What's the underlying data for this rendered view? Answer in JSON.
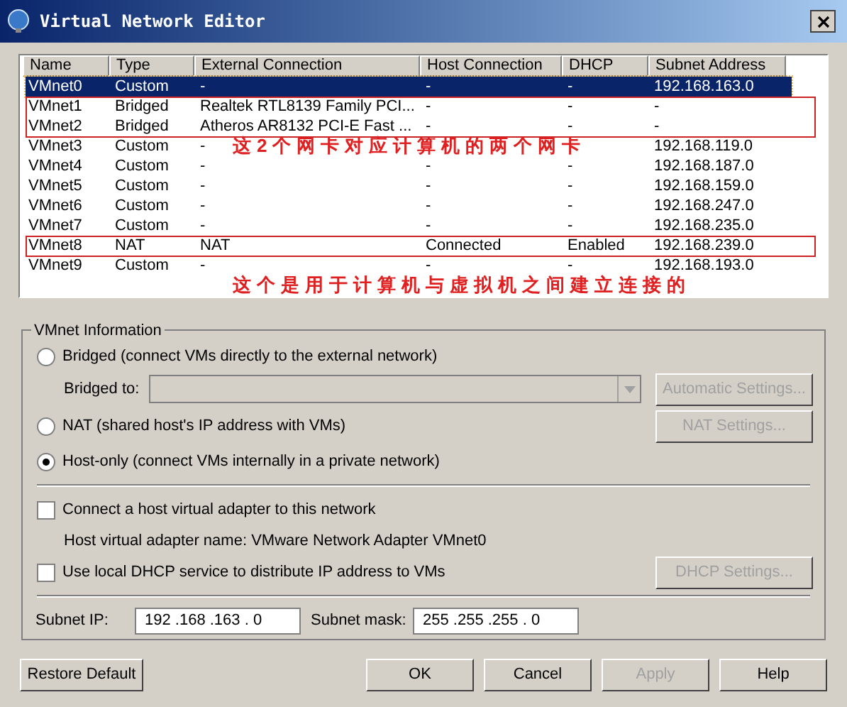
{
  "window": {
    "title": "Virtual Network Editor"
  },
  "table": {
    "columns": [
      "Name",
      "Type",
      "External Connection",
      "Host Connection",
      "DHCP",
      "Subnet Address"
    ],
    "rows": [
      {
        "name": "VMnet0",
        "type": "Custom",
        "external": "-",
        "host": "-",
        "dhcp": "-",
        "subnet": "192.168.163.0",
        "selected": true,
        "outlined": false
      },
      {
        "name": "VMnet1",
        "type": "Bridged",
        "external": "Realtek RTL8139 Family PCI...",
        "host": "-",
        "dhcp": "-",
        "subnet": "-",
        "selected": false,
        "outlined": true
      },
      {
        "name": "VMnet2",
        "type": "Bridged",
        "external": "Atheros AR8132 PCI-E Fast ...",
        "host": "-",
        "dhcp": "-",
        "subnet": "-",
        "selected": false,
        "outlined": true
      },
      {
        "name": "VMnet3",
        "type": "Custom",
        "external": "-",
        "subnet": "192.168.119.0",
        "selected": false,
        "outlined": false
      },
      {
        "name": "VMnet4",
        "type": "Custom",
        "external": "-",
        "host": "-",
        "dhcp": "-",
        "subnet": "192.168.187.0",
        "selected": false,
        "outlined": false
      },
      {
        "name": "VMnet5",
        "type": "Custom",
        "external": "-",
        "host": "-",
        "dhcp": "-",
        "subnet": "192.168.159.0",
        "selected": false,
        "outlined": false
      },
      {
        "name": "VMnet6",
        "type": "Custom",
        "external": "-",
        "host": "-",
        "dhcp": "-",
        "subnet": "192.168.247.0",
        "selected": false,
        "outlined": false
      },
      {
        "name": "VMnet7",
        "type": "Custom",
        "external": "-",
        "host": "-",
        "dhcp": "-",
        "subnet": "192.168.235.0",
        "selected": false,
        "outlined": false
      },
      {
        "name": "VMnet8",
        "type": "NAT",
        "external": "NAT",
        "host": "Connected",
        "dhcp": "Enabled",
        "subnet": "192.168.239.0",
        "selected": false,
        "outlined": true
      },
      {
        "name": "VMnet9",
        "type": "Custom",
        "external": "-",
        "host": "-",
        "dhcp": "-",
        "subnet": "192.168.193.0",
        "selected": false,
        "outlined": false
      }
    ]
  },
  "annotations": [
    "这2个网卡对应计算机的两个网卡",
    "这个是用于计算机与虚拟机之间建立连接的"
  ],
  "vmnet_information": {
    "title": "VMnet Information",
    "modes": [
      {
        "label": "Bridged (connect VMs directly to the external network)",
        "selected": false
      },
      {
        "label": "NAT (shared host's IP address with VMs)",
        "selected": false
      },
      {
        "label": "Host-only (connect VMs internally in a private network)",
        "selected": true
      }
    ],
    "bridged_to": {
      "label": "Bridged to:",
      "disabled": true
    },
    "automatic_settings": {
      "label": "Automatic Settings...",
      "disabled": true
    },
    "nat_settings": {
      "label": "NAT Settings...",
      "disabled": true
    },
    "connect_adapter": {
      "label": "Connect a host virtual adapter to this network",
      "checked": false
    },
    "adapter_name": "Host virtual adapter name: VMware Network Adapter VMnet0",
    "use_dhcp": {
      "label": "Use local DHCP service to distribute IP address to VMs",
      "checked": false
    },
    "dhcp_settings": {
      "label": "DHCP Settings...",
      "disabled": true
    },
    "subnet_ip": {
      "label": "Subnet IP:",
      "value": "192 .168 .163 . 0"
    },
    "subnet_mask": {
      "label": "Subnet mask:",
      "value": "255 .255 .255 . 0"
    }
  },
  "buttons": [
    {
      "label": "Restore Default",
      "disabled": false
    },
    {
      "label": "OK",
      "disabled": false
    },
    {
      "label": "Cancel",
      "disabled": false
    },
    {
      "label": "Apply",
      "disabled": true
    },
    {
      "label": "Help",
      "disabled": false
    }
  ]
}
